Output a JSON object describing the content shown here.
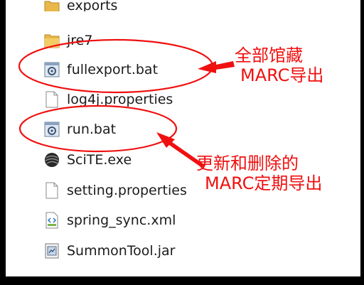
{
  "files": [
    {
      "name": "exports",
      "icon": "folder-icon"
    },
    {
      "name": "jre7",
      "icon": "folder-icon"
    },
    {
      "name": "fullexport.bat",
      "icon": "batch-file-icon"
    },
    {
      "name": "log4j.properties",
      "icon": "document-icon"
    },
    {
      "name": "run.bat",
      "icon": "batch-file-icon"
    },
    {
      "name": "SciTE.exe",
      "icon": "scite-exe-icon"
    },
    {
      "name": "setting.properties",
      "icon": "document-icon"
    },
    {
      "name": "spring_sync.xml",
      "icon": "xml-file-icon"
    },
    {
      "name": "SummonTool.jar",
      "icon": "jar-file-icon"
    }
  ],
  "annotations": {
    "full_export": {
      "line1": "全部馆藏",
      "line2": "MARC导出"
    },
    "scheduled_export": {
      "line1": "更新和删除的",
      "line2": "MARC定期导出"
    }
  },
  "colors": {
    "annotation": "#f01010",
    "folder": "#e8b84a",
    "background": "#ffffff"
  }
}
